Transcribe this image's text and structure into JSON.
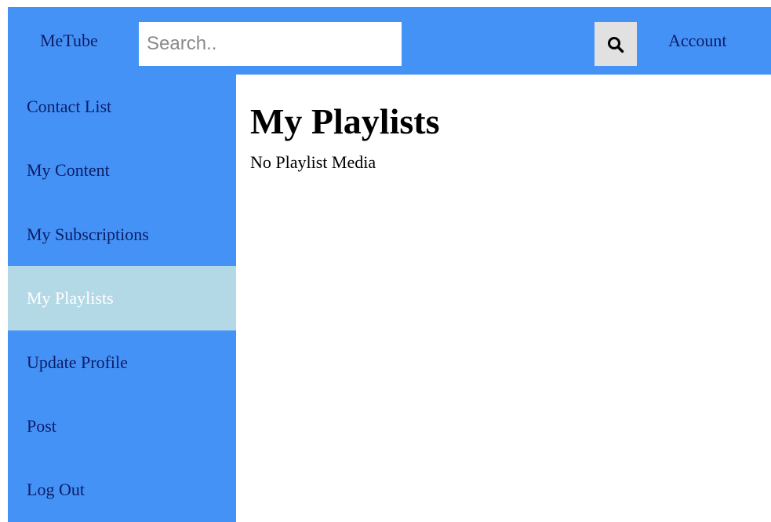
{
  "header": {
    "brand": "MeTube",
    "search": {
      "placeholder": "Search..",
      "value": ""
    },
    "search_button_icon": "search-icon",
    "account_label": "Account"
  },
  "sidebar": {
    "active_index": 3,
    "items": [
      {
        "label": "Contact List"
      },
      {
        "label": "My Content"
      },
      {
        "label": "My Subscriptions"
      },
      {
        "label": "My Playlists"
      },
      {
        "label": "Update Profile"
      },
      {
        "label": "Post"
      },
      {
        "label": "Log Out"
      }
    ]
  },
  "main": {
    "title": "My Playlists",
    "empty_message": "No Playlist Media"
  },
  "colors": {
    "primary": "#4592f7",
    "active_item": "#b3d8e6",
    "link_text": "#0b1c66"
  }
}
